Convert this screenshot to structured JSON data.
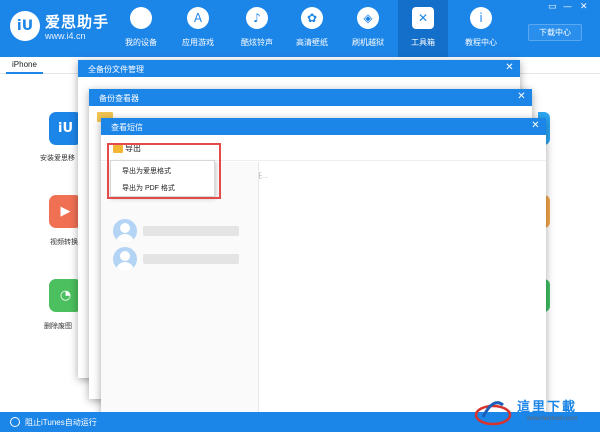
{
  "app": {
    "brand_name": "爱思助手",
    "brand_url": "www.i4.cn",
    "logo_text": "iU",
    "download_center": "下载中心"
  },
  "nav": [
    {
      "label": "我的设备",
      "icon": "apple-icon",
      "glyph": ""
    },
    {
      "label": "应用游戏",
      "icon": "app-store-icon",
      "glyph": "A"
    },
    {
      "label": "酷炫铃声",
      "icon": "bell-icon",
      "glyph": "♪"
    },
    {
      "label": "高清壁纸",
      "icon": "flower-icon",
      "glyph": "✿"
    },
    {
      "label": "刷机越狱",
      "icon": "dropbox-icon",
      "glyph": "◈"
    },
    {
      "label": "工具箱",
      "icon": "tools-icon",
      "glyph": "✕"
    },
    {
      "label": "教程中心",
      "icon": "info-icon",
      "glyph": "i"
    }
  ],
  "window_controls": [
    "▭",
    "—",
    "✕"
  ],
  "device_tab": "iPhone",
  "tools": [
    {
      "label": "安装爱思移",
      "glyph": "iU",
      "color": "#1c85e8"
    },
    {
      "label": "视频转换",
      "glyph": "▶",
      "color": "#f07054"
    },
    {
      "label": "删除废图",
      "glyph": "◔",
      "color": "#4cc05e"
    }
  ],
  "dialogs": {
    "full_backup_title": "全备份文件管理",
    "backup_viewer_title": "备份查看器",
    "view_sms_title": "查看短信",
    "close_glyph": "✕"
  },
  "export": {
    "button_label": "导出",
    "menu_items": [
      "导出为爱思格式",
      "导出为 PDF 格式"
    ]
  },
  "list_hint": "有要任...",
  "bottom": {
    "stop_itunes": "阻止iTunes自动运行"
  },
  "watermark": {
    "text": "這里下載",
    "url": "www.herdown.com"
  },
  "colors": {
    "brand_blue": "#1c85e8",
    "highlight_red": "#e34a4a"
  }
}
